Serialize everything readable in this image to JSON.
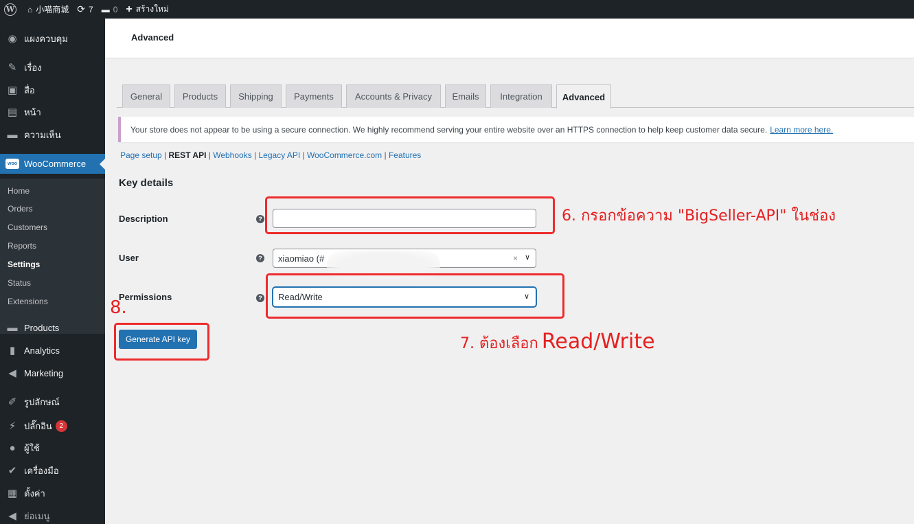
{
  "adminbar": {
    "site_name": "小喵商城",
    "updates_count": "7",
    "comments_count": "0",
    "new_label": "สร้างใหม่"
  },
  "sidebar": {
    "items": [
      {
        "label": "แผงควบคุม",
        "icon": "dashboard-icon"
      },
      {
        "label": "เรื่อง",
        "icon": "pin-icon"
      },
      {
        "label": "สื่อ",
        "icon": "media-icon"
      },
      {
        "label": "หน้า",
        "icon": "page-icon"
      },
      {
        "label": "ความเห็น",
        "icon": "comment-icon"
      },
      {
        "label": "WooCommerce",
        "icon": "woo-icon"
      },
      {
        "label": "Products",
        "icon": "products-icon"
      },
      {
        "label": "Analytics",
        "icon": "analytics-icon"
      },
      {
        "label": "Marketing",
        "icon": "megaphone-icon"
      },
      {
        "label": "รูปลักษณ์",
        "icon": "brush-icon"
      },
      {
        "label": "ปลั๊กอิน",
        "icon": "plugin-icon",
        "badge": "2"
      },
      {
        "label": "ผู้ใช้",
        "icon": "user-icon"
      },
      {
        "label": "เครื่องมือ",
        "icon": "wrench-icon"
      },
      {
        "label": "ตั้งค่า",
        "icon": "settings-icon"
      },
      {
        "label": "ย่อเมนู",
        "icon": "collapse-icon"
      }
    ],
    "submenu": [
      "Home",
      "Orders",
      "Customers",
      "Reports",
      "Settings",
      "Status",
      "Extensions"
    ]
  },
  "header": {
    "title": "Advanced"
  },
  "tabs": [
    "General",
    "Products",
    "Shipping",
    "Payments",
    "Accounts & Privacy",
    "Emails",
    "Integration",
    "Advanced"
  ],
  "notice": {
    "text": "Your store does not appear to be using a secure connection. We highly recommend serving your entire website over an HTTPS connection to help keep customer data secure.",
    "link": "Learn more here."
  },
  "subnav": [
    "Page setup",
    "REST API",
    "Webhooks",
    "Legacy API",
    "WooCommerce.com",
    "Features"
  ],
  "form": {
    "section_title": "Key details",
    "description_label": "Description",
    "description_value": "",
    "user_label": "User",
    "user_value": "xiaomiao (#",
    "user_clear": "×",
    "permissions_label": "Permissions",
    "permissions_value": "Read/Write",
    "generate_button": "Generate API key"
  },
  "annotations": {
    "step6": "6. กรอกข้อความ \"BigSeller-API\" ในช่อง",
    "step7_prefix": "7. ต้องเลือก",
    "step7_value": "Read/Write",
    "step8": "8."
  },
  "colors": {
    "admin_dark": "#1d2327",
    "accent_blue": "#2271b1",
    "annotation_red": "#ee2b2b"
  }
}
